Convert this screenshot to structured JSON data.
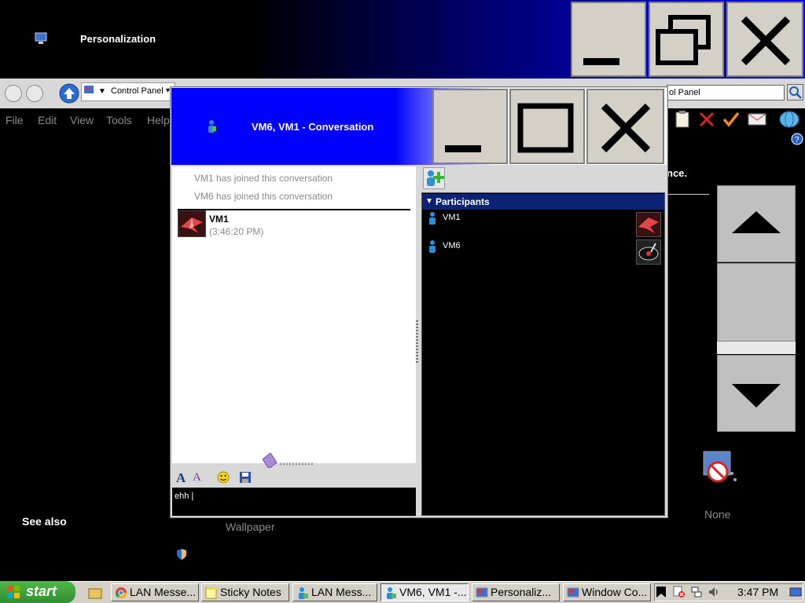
{
  "background_window": {
    "title": "Personalization",
    "address_crumb": "Control Panel",
    "search_value": "ol Panel",
    "menu": [
      "File",
      "Edit",
      "View",
      "Tools",
      "Help"
    ],
    "partial_text": "nce.",
    "see_also": "See also",
    "wallpaper_label": "Wallpaper",
    "screensaver_label": "None"
  },
  "conversation_window": {
    "title": "VM6, VM1 - Conversation",
    "system_messages": [
      "VM1 has joined this conversation",
      "VM6 has joined this conversation"
    ],
    "message": {
      "sender": "VM1",
      "time": "(3:46:20 PM)"
    },
    "input_value": "ehh |",
    "participants_header": "Participants",
    "participants": [
      {
        "name": "VM1"
      },
      {
        "name": "VM6"
      }
    ]
  },
  "taskbar": {
    "start_label": "start",
    "buttons": [
      {
        "label": "LAN Messe..."
      },
      {
        "label": "Sticky Notes"
      },
      {
        "label": "LAN Mess..."
      },
      {
        "label": "VM6, VM1 -..."
      },
      {
        "label": "Personaliz..."
      },
      {
        "label": "Window Co..."
      }
    ],
    "clock": "3:47 PM"
  },
  "colors": {
    "title_blue": "#0000ff",
    "participants_header": "#0b2275",
    "taskbar": "#d4d0c8",
    "start_green": "#3aa336"
  },
  "icons": [
    "monitor-icon",
    "back-icon",
    "forward-icon",
    "up-icon",
    "search-icon",
    "add-contact-icon",
    "font-icon",
    "font-color-icon",
    "smiley-icon",
    "save-icon",
    "user-icon",
    "help-icon",
    "screensaver-icon",
    "shield-icon",
    "windows-logo-icon",
    "quick-launch-icon",
    "chrome-icon",
    "sticky-notes-icon",
    "messenger-icon",
    "personalization-icon",
    "window-color-icon",
    "volume-icon",
    "network-icon"
  ]
}
